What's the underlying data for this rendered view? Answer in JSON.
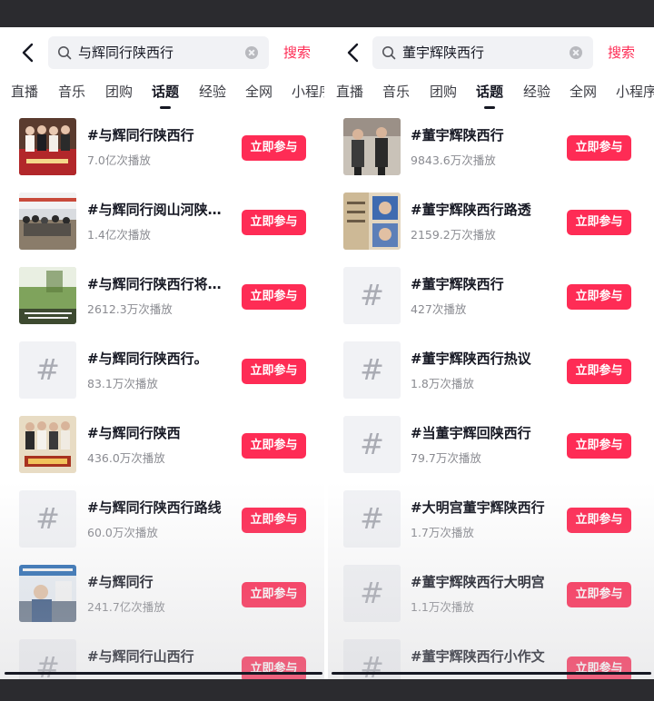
{
  "accent_color": "#fe2c55",
  "panels": [
    {
      "search_query": "与辉同行陕西行",
      "search_button": "搜索",
      "tabs": [
        "直播",
        "音乐",
        "团购",
        "话题",
        "经验",
        "全网",
        "小程序"
      ],
      "active_tab": "话题",
      "join_label": "立即参与",
      "items": [
        {
          "title": "#与辉同行陕西行",
          "plays": "7.0亿次播放",
          "thumb": "photo"
        },
        {
          "title": "#与辉同行阅山河陕…",
          "plays": "1.4亿次播放",
          "thumb": "photo"
        },
        {
          "title": "#与辉同行陕西行将…",
          "plays": "2612.3万次播放",
          "thumb": "photo"
        },
        {
          "title": "#与辉同行陕西行。",
          "plays": "83.1万次播放",
          "thumb": "hash"
        },
        {
          "title": "#与辉同行陕西",
          "plays": "436.0万次播放",
          "thumb": "photo"
        },
        {
          "title": "#与辉同行陕西行路线",
          "plays": "60.0万次播放",
          "thumb": "hash"
        },
        {
          "title": "#与辉同行",
          "plays": "241.7亿次播放",
          "thumb": "photo"
        },
        {
          "title": "#与辉同行山西行",
          "plays": "",
          "thumb": "hash"
        }
      ]
    },
    {
      "search_query": "董宇辉陕西行",
      "search_button": "搜索",
      "tabs": [
        "直播",
        "音乐",
        "团购",
        "话题",
        "经验",
        "全网",
        "小程序"
      ],
      "active_tab": "话题",
      "join_label": "立即参与",
      "items": [
        {
          "title": "#董宇辉陕西行",
          "plays": "9843.6万次播放",
          "thumb": "photo"
        },
        {
          "title": "#董宇辉陕西行路透",
          "plays": "2159.2万次播放",
          "thumb": "photo"
        },
        {
          "title": "#董宇辉陕西行",
          "plays": "427次播放",
          "thumb": "hash"
        },
        {
          "title": "#董宇辉陕西行热议",
          "plays": "1.8万次播放",
          "thumb": "hash"
        },
        {
          "title": "#当董宇辉回陕西行",
          "plays": "79.7万次播放",
          "thumb": "hash"
        },
        {
          "title": "#大明宫董宇辉陕西行",
          "plays": "1.7万次播放",
          "thumb": "hash"
        },
        {
          "title": "#董宇辉陕西行大明宫",
          "plays": "1.1万次播放",
          "thumb": "hash"
        },
        {
          "title": "#董宇辉陕西行小作文",
          "plays": "",
          "thumb": "hash"
        }
      ]
    }
  ]
}
